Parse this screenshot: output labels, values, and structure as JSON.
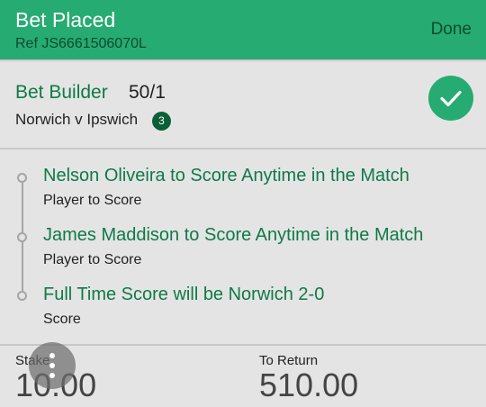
{
  "header": {
    "title": "Bet Placed",
    "ref": "Ref JS6661506070L",
    "done_label": "Done"
  },
  "bet": {
    "name": "Bet Builder",
    "odds": "50/1",
    "match": "Norwich v Ipswich",
    "selection_count": "3",
    "status_icon": "check-icon"
  },
  "selections": [
    {
      "title": "Nelson Oliveira to Score Anytime in the Match",
      "market": "Player to Score"
    },
    {
      "title": "James Maddison to Score Anytime in the Match",
      "market": "Player to Score"
    },
    {
      "title": "Full Time Score will be Norwich 2-0",
      "market": "Score"
    }
  ],
  "footer": {
    "stake_label": "Stake",
    "stake_value": "10.00",
    "return_label": "To Return",
    "return_value": "510.00"
  },
  "fab_icon": "more-vertical-icon",
  "colors": {
    "brand_green": "#26ab72",
    "dark_green": "#0e7a48",
    "badge_green": "#0b5f37",
    "background": "#e4e4e4"
  }
}
